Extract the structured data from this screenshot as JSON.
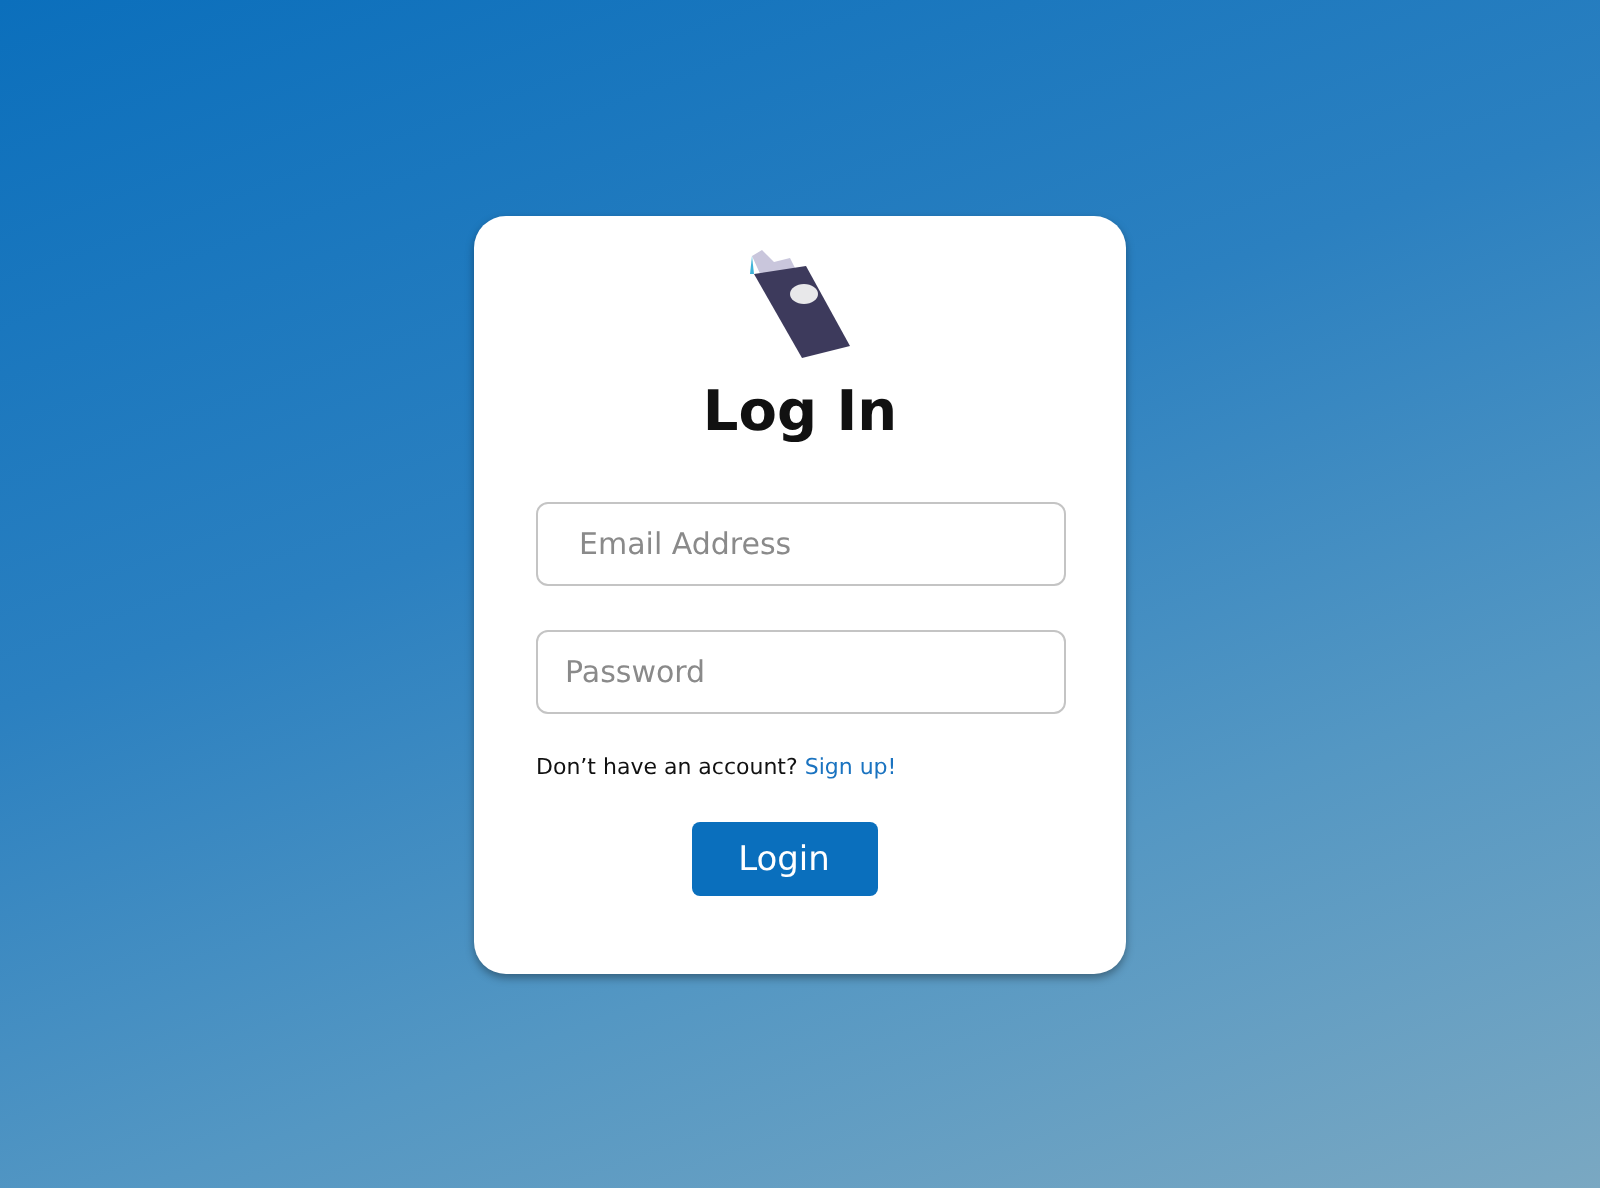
{
  "title": "Log In",
  "fields": [
    {
      "placeholder": "Email Address"
    },
    {
      "placeholder": "Password"
    }
  ],
  "signup": {
    "prompt": "Don’t have an account?",
    "link": "Sign up!"
  },
  "button": "Login"
}
